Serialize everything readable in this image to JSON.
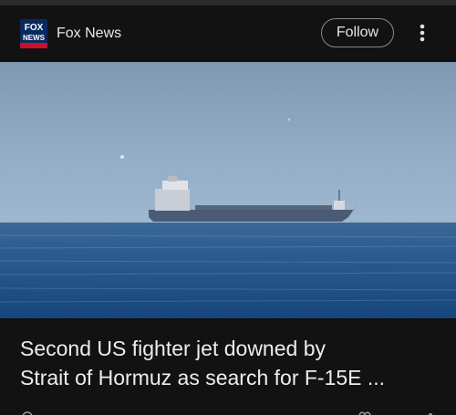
{
  "header": {
    "source_name": "Fox News",
    "logo_text_top": "FOX",
    "logo_text_bottom": "NEWS",
    "follow_label": "Follow",
    "more_icon": "more-vert-icon"
  },
  "article": {
    "headline_line1": "Second US fighter jet downed by",
    "headline_line2": "Strait of Hormuz as search for F-15E ..."
  },
  "colors": {
    "background": "#121212",
    "text": "#ededed",
    "sky": "#8fa6bd",
    "sea": "#1f4f85"
  }
}
